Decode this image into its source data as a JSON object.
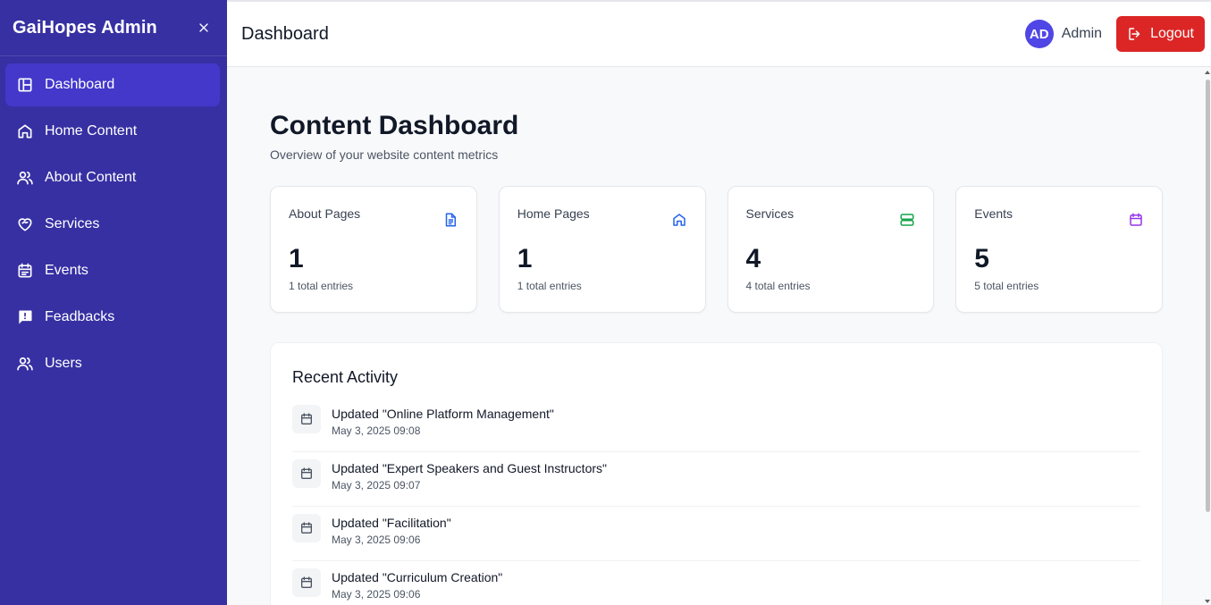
{
  "sidebar": {
    "brand": "GaiHopes Admin",
    "items": [
      {
        "label": "Dashboard",
        "icon": "dashboard-icon",
        "active": true
      },
      {
        "label": "Home Content",
        "icon": "home-icon"
      },
      {
        "label": "About Content",
        "icon": "users-icon"
      },
      {
        "label": "Services",
        "icon": "heart-handshake-icon"
      },
      {
        "label": "Events",
        "icon": "calendar-icon"
      },
      {
        "label": "Feadbacks",
        "icon": "feedback-icon"
      },
      {
        "label": "Users",
        "icon": "users-icon"
      }
    ]
  },
  "header": {
    "title": "Dashboard",
    "avatar_initials": "AD",
    "user_name": "Admin",
    "logout_label": "Logout"
  },
  "main": {
    "title": "Content Dashboard",
    "subtitle": "Overview of your website content metrics",
    "stats": [
      {
        "label": "About Pages",
        "value": "1",
        "sub": "1 total entries",
        "icon": "document-icon",
        "color": "#2563eb"
      },
      {
        "label": "Home Pages",
        "value": "1",
        "sub": "1 total entries",
        "icon": "home-icon",
        "color": "#2563eb"
      },
      {
        "label": "Services",
        "value": "4",
        "sub": "4 total entries",
        "icon": "server-icon",
        "color": "#16a34a"
      },
      {
        "label": "Events",
        "value": "5",
        "sub": "5 total entries",
        "icon": "calendar-icon",
        "color": "#9333ea"
      }
    ],
    "activity": {
      "title": "Recent Activity",
      "items": [
        {
          "name": "Updated \"Online Platform Management\"",
          "date": "May 3, 2025 09:08"
        },
        {
          "name": "Updated \"Expert Speakers and Guest Instructors\"",
          "date": "May 3, 2025 09:07"
        },
        {
          "name": "Updated \"Facilitation\"",
          "date": "May 3, 2025 09:06"
        },
        {
          "name": "Updated \"Curriculum Creation\"",
          "date": "May 3, 2025 09:06"
        }
      ]
    }
  },
  "colors": {
    "sidebar_bg": "#3730a3",
    "sidebar_active": "#4338ca",
    "logout_bg": "#dc2626",
    "avatar_bg": "#4f46e5"
  }
}
